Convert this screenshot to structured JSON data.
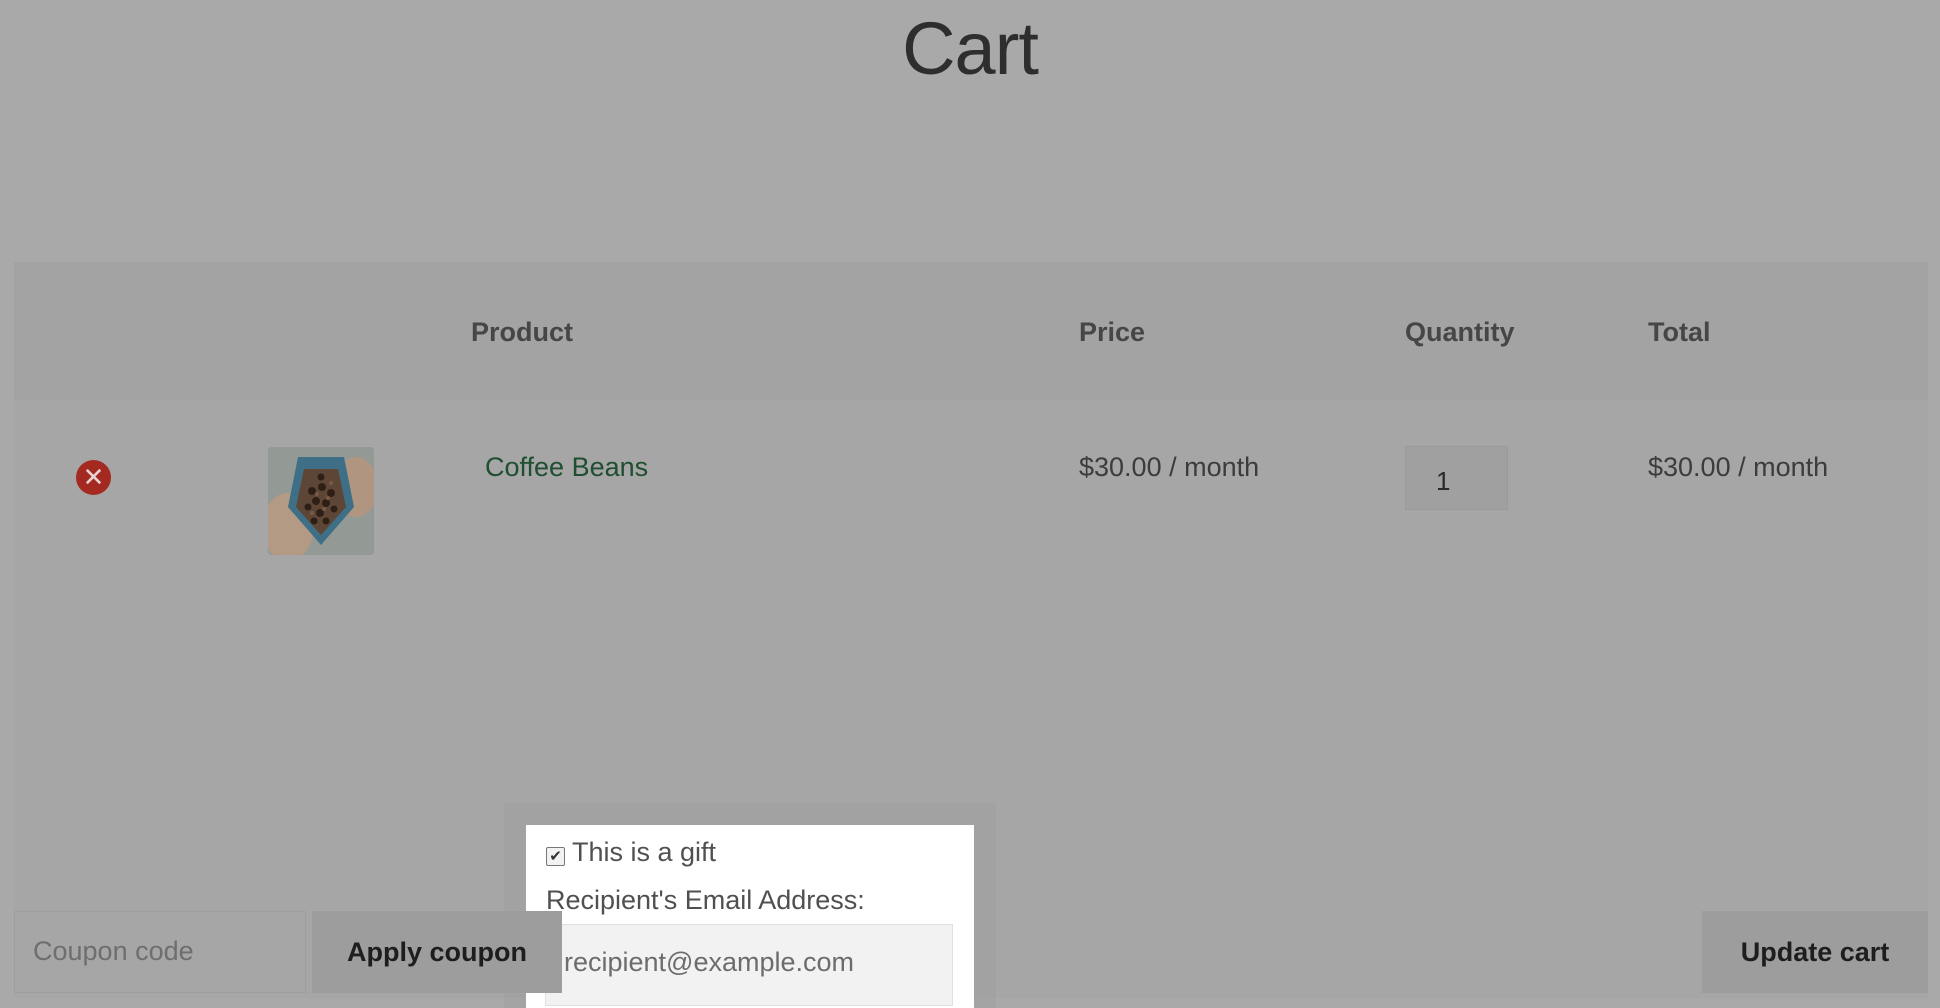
{
  "page": {
    "title": "Cart"
  },
  "table": {
    "headers": {
      "product": "Product",
      "price": "Price",
      "quantity": "Quantity",
      "total": "Total"
    }
  },
  "item": {
    "remove_glyph": "✕",
    "product_name": "Coffee Beans",
    "price": "$30.00 / month",
    "quantity": "1",
    "total": "$30.00 / month",
    "gift": {
      "checked": true,
      "check_glyph": "✔",
      "label": "This is a gift",
      "email_label": "Recipient's Email Address:",
      "email_placeholder": "recipient@example.com"
    }
  },
  "actions": {
    "coupon_placeholder": "Coupon code",
    "apply_coupon": "Apply coupon",
    "update_cart": "Update cart"
  },
  "colors": {
    "link": "#1f4e30",
    "remove": "#a42a21",
    "overlay": "#a9a9a9"
  }
}
